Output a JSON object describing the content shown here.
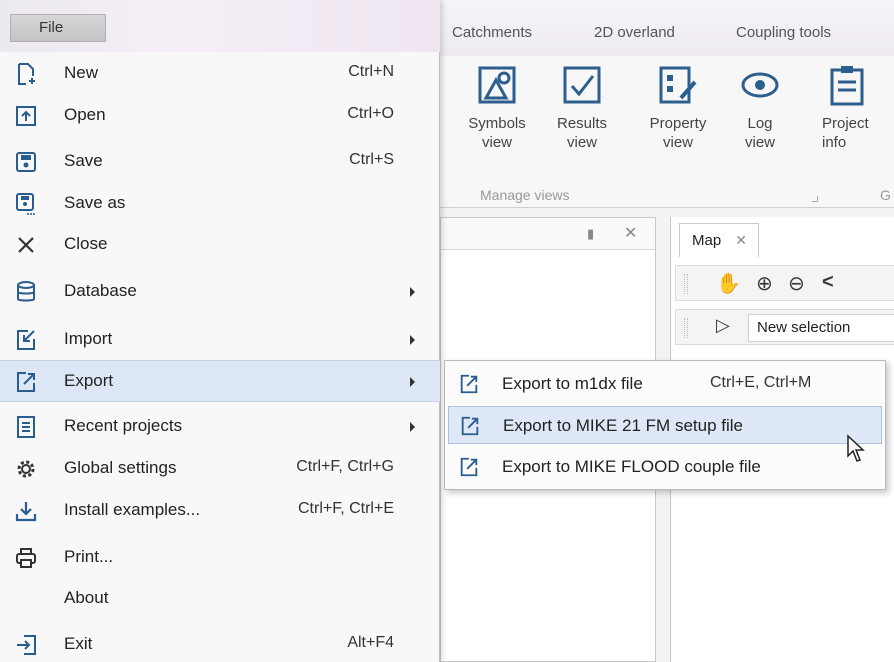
{
  "ribbon": {
    "tabs": [
      "Catchments",
      "2D overland",
      "Coupling tools"
    ],
    "buttons": [
      {
        "label": "Symbols view",
        "icon": "symbols-view-icon"
      },
      {
        "label": "Results view",
        "icon": "results-view-icon"
      },
      {
        "label": "Property view",
        "icon": "property-view-icon"
      },
      {
        "label": "Log view",
        "icon": "log-view-icon"
      },
      {
        "label": "Project info",
        "icon": "project-info-icon"
      }
    ],
    "group_label": "Manage views",
    "group_label_2": "G"
  },
  "map_panel": {
    "tab_label": "Map",
    "selection_value": "New selection"
  },
  "file_menu": {
    "button_label": "File",
    "items": [
      {
        "label": "New",
        "shortcut": "Ctrl+N",
        "icon": "new-file-icon",
        "submenu": false
      },
      {
        "label": "Open",
        "shortcut": "Ctrl+O",
        "icon": "open-icon",
        "submenu": false
      },
      {
        "label": "Save",
        "shortcut": "Ctrl+S",
        "icon": "save-icon",
        "submenu": false
      },
      {
        "label": "Save as",
        "shortcut": "",
        "icon": "save-as-icon",
        "submenu": false
      },
      {
        "label": "Close",
        "shortcut": "",
        "icon": "close-icon",
        "submenu": false
      },
      {
        "label": "Database",
        "shortcut": "",
        "icon": "database-icon",
        "submenu": true
      },
      {
        "label": "Import",
        "shortcut": "",
        "icon": "import-icon",
        "submenu": true
      },
      {
        "label": "Export",
        "shortcut": "",
        "icon": "export-icon",
        "submenu": true
      },
      {
        "label": "Recent projects",
        "shortcut": "",
        "icon": "recent-projects-icon",
        "submenu": true
      },
      {
        "label": "Global settings",
        "shortcut": "Ctrl+F, Ctrl+G",
        "icon": "gear-icon",
        "submenu": false
      },
      {
        "label": "Install examples...",
        "shortcut": "Ctrl+F, Ctrl+E",
        "icon": "download-icon",
        "submenu": false
      },
      {
        "label": "Print...",
        "shortcut": "",
        "icon": "printer-icon",
        "submenu": false
      },
      {
        "label": "About",
        "shortcut": "",
        "icon": "",
        "submenu": false
      },
      {
        "label": "Exit",
        "shortcut": "Alt+F4",
        "icon": "exit-icon",
        "submenu": false
      }
    ]
  },
  "export_submenu": {
    "items": [
      {
        "label": "Export to m1dx file",
        "shortcut": "Ctrl+E, Ctrl+M"
      },
      {
        "label": "Export to MIKE 21 FM setup file",
        "shortcut": ""
      },
      {
        "label": "Export to MIKE FLOOD couple file",
        "shortcut": ""
      }
    ]
  },
  "colors": {
    "menu_highlight": "#dde6f4",
    "submenu_hover": "#dfe8f6",
    "icon_blue": "#2a5d8f"
  }
}
